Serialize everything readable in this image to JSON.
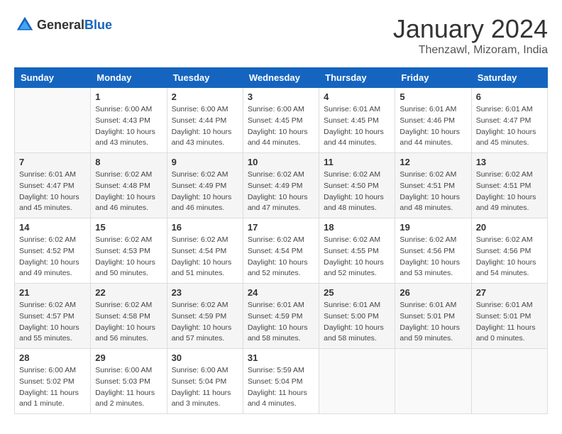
{
  "header": {
    "logo_general": "General",
    "logo_blue": "Blue",
    "month_title": "January 2024",
    "subtitle": "Thenzawl, Mizoram, India"
  },
  "weekdays": [
    "Sunday",
    "Monday",
    "Tuesday",
    "Wednesday",
    "Thursday",
    "Friday",
    "Saturday"
  ],
  "weeks": [
    {
      "shaded": false,
      "days": [
        {
          "num": "",
          "info": ""
        },
        {
          "num": "1",
          "info": "Sunrise: 6:00 AM\nSunset: 4:43 PM\nDaylight: 10 hours\nand 43 minutes."
        },
        {
          "num": "2",
          "info": "Sunrise: 6:00 AM\nSunset: 4:44 PM\nDaylight: 10 hours\nand 43 minutes."
        },
        {
          "num": "3",
          "info": "Sunrise: 6:00 AM\nSunset: 4:45 PM\nDaylight: 10 hours\nand 44 minutes."
        },
        {
          "num": "4",
          "info": "Sunrise: 6:01 AM\nSunset: 4:45 PM\nDaylight: 10 hours\nand 44 minutes."
        },
        {
          "num": "5",
          "info": "Sunrise: 6:01 AM\nSunset: 4:46 PM\nDaylight: 10 hours\nand 44 minutes."
        },
        {
          "num": "6",
          "info": "Sunrise: 6:01 AM\nSunset: 4:47 PM\nDaylight: 10 hours\nand 45 minutes."
        }
      ]
    },
    {
      "shaded": true,
      "days": [
        {
          "num": "7",
          "info": "Sunrise: 6:01 AM\nSunset: 4:47 PM\nDaylight: 10 hours\nand 45 minutes."
        },
        {
          "num": "8",
          "info": "Sunrise: 6:02 AM\nSunset: 4:48 PM\nDaylight: 10 hours\nand 46 minutes."
        },
        {
          "num": "9",
          "info": "Sunrise: 6:02 AM\nSunset: 4:49 PM\nDaylight: 10 hours\nand 46 minutes."
        },
        {
          "num": "10",
          "info": "Sunrise: 6:02 AM\nSunset: 4:49 PM\nDaylight: 10 hours\nand 47 minutes."
        },
        {
          "num": "11",
          "info": "Sunrise: 6:02 AM\nSunset: 4:50 PM\nDaylight: 10 hours\nand 48 minutes."
        },
        {
          "num": "12",
          "info": "Sunrise: 6:02 AM\nSunset: 4:51 PM\nDaylight: 10 hours\nand 48 minutes."
        },
        {
          "num": "13",
          "info": "Sunrise: 6:02 AM\nSunset: 4:51 PM\nDaylight: 10 hours\nand 49 minutes."
        }
      ]
    },
    {
      "shaded": false,
      "days": [
        {
          "num": "14",
          "info": "Sunrise: 6:02 AM\nSunset: 4:52 PM\nDaylight: 10 hours\nand 49 minutes."
        },
        {
          "num": "15",
          "info": "Sunrise: 6:02 AM\nSunset: 4:53 PM\nDaylight: 10 hours\nand 50 minutes."
        },
        {
          "num": "16",
          "info": "Sunrise: 6:02 AM\nSunset: 4:54 PM\nDaylight: 10 hours\nand 51 minutes."
        },
        {
          "num": "17",
          "info": "Sunrise: 6:02 AM\nSunset: 4:54 PM\nDaylight: 10 hours\nand 52 minutes."
        },
        {
          "num": "18",
          "info": "Sunrise: 6:02 AM\nSunset: 4:55 PM\nDaylight: 10 hours\nand 52 minutes."
        },
        {
          "num": "19",
          "info": "Sunrise: 6:02 AM\nSunset: 4:56 PM\nDaylight: 10 hours\nand 53 minutes."
        },
        {
          "num": "20",
          "info": "Sunrise: 6:02 AM\nSunset: 4:56 PM\nDaylight: 10 hours\nand 54 minutes."
        }
      ]
    },
    {
      "shaded": true,
      "days": [
        {
          "num": "21",
          "info": "Sunrise: 6:02 AM\nSunset: 4:57 PM\nDaylight: 10 hours\nand 55 minutes."
        },
        {
          "num": "22",
          "info": "Sunrise: 6:02 AM\nSunset: 4:58 PM\nDaylight: 10 hours\nand 56 minutes."
        },
        {
          "num": "23",
          "info": "Sunrise: 6:02 AM\nSunset: 4:59 PM\nDaylight: 10 hours\nand 57 minutes."
        },
        {
          "num": "24",
          "info": "Sunrise: 6:01 AM\nSunset: 4:59 PM\nDaylight: 10 hours\nand 58 minutes."
        },
        {
          "num": "25",
          "info": "Sunrise: 6:01 AM\nSunset: 5:00 PM\nDaylight: 10 hours\nand 58 minutes."
        },
        {
          "num": "26",
          "info": "Sunrise: 6:01 AM\nSunset: 5:01 PM\nDaylight: 10 hours\nand 59 minutes."
        },
        {
          "num": "27",
          "info": "Sunrise: 6:01 AM\nSunset: 5:01 PM\nDaylight: 11 hours\nand 0 minutes."
        }
      ]
    },
    {
      "shaded": false,
      "days": [
        {
          "num": "28",
          "info": "Sunrise: 6:00 AM\nSunset: 5:02 PM\nDaylight: 11 hours\nand 1 minute."
        },
        {
          "num": "29",
          "info": "Sunrise: 6:00 AM\nSunset: 5:03 PM\nDaylight: 11 hours\nand 2 minutes."
        },
        {
          "num": "30",
          "info": "Sunrise: 6:00 AM\nSunset: 5:04 PM\nDaylight: 11 hours\nand 3 minutes."
        },
        {
          "num": "31",
          "info": "Sunrise: 5:59 AM\nSunset: 5:04 PM\nDaylight: 11 hours\nand 4 minutes."
        },
        {
          "num": "",
          "info": ""
        },
        {
          "num": "",
          "info": ""
        },
        {
          "num": "",
          "info": ""
        }
      ]
    }
  ]
}
